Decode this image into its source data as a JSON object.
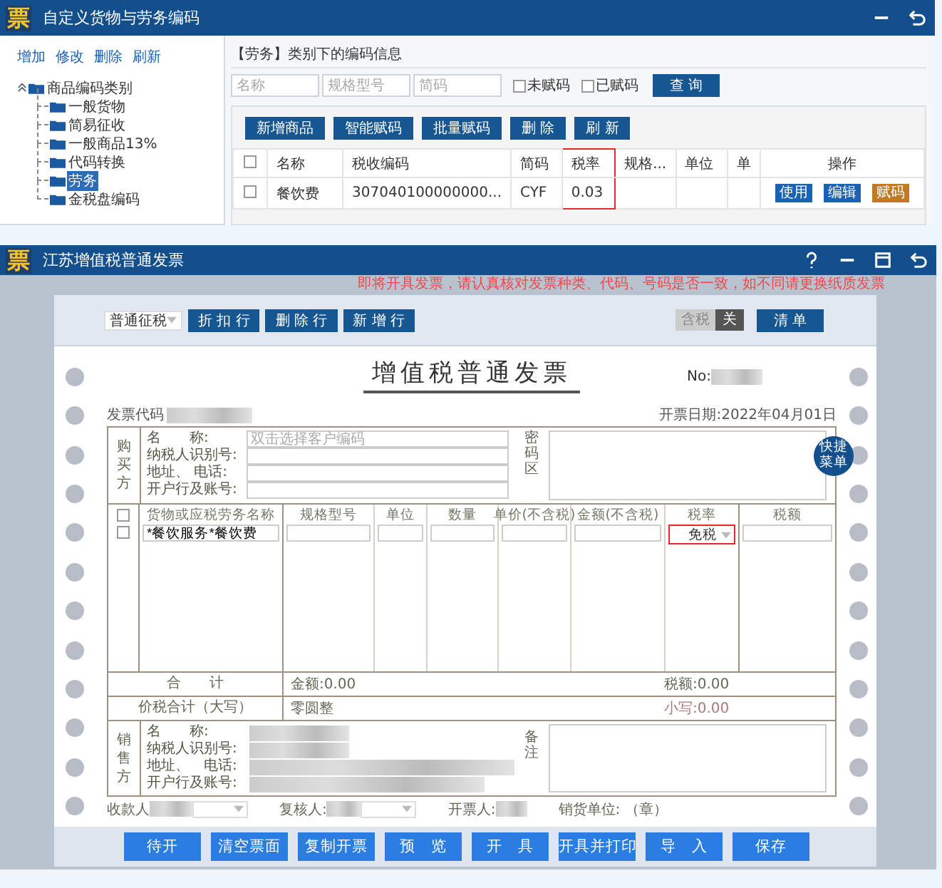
{
  "code_window": {
    "logo": "票",
    "title": "自定义货物与劳务编码",
    "actions": [
      "增加",
      "修改",
      "删除",
      "刷新"
    ],
    "tree": {
      "label": "商品编码类别",
      "expanded": true,
      "children": [
        {
          "label": "一般货物",
          "selected": false
        },
        {
          "label": "简易征收",
          "selected": false
        },
        {
          "label": "一般商品13%",
          "selected": false
        },
        {
          "label": "代码转换",
          "selected": false
        },
        {
          "label": "劳务",
          "selected": true
        },
        {
          "label": "金税盘编码",
          "selected": false
        }
      ]
    },
    "heading": "【劳务】类别下的编码信息",
    "filters": [
      {
        "placeholder": "名称"
      },
      {
        "placeholder": "规格型号"
      },
      {
        "placeholder": "简码"
      }
    ],
    "checks": [
      {
        "label": "未赋码",
        "checked": false
      },
      {
        "label": "已赋码",
        "checked": false
      }
    ],
    "query_button": "查 询",
    "toolbar": [
      "新增商品",
      "智能赋码",
      "批量赋码",
      "删 除",
      "刷 新"
    ],
    "table": {
      "header_checked": false,
      "columns": [
        {
          "label": "名称",
          "highlighted": false
        },
        {
          "label": "税收编码",
          "highlighted": false
        },
        {
          "label": "简码",
          "highlighted": false
        },
        {
          "label": "税率",
          "highlighted": true
        },
        {
          "label": "规格...",
          "highlighted": false
        },
        {
          "label": "单位",
          "highlighted": false
        },
        {
          "label": "单",
          "highlighted": false
        }
      ],
      "action_column": "操作",
      "rows": [
        {
          "checked": false,
          "cells": [
            "餐饮费",
            "307040100000000...",
            "CYF",
            "0.03"
          ],
          "actions": [
            {
              "label": "使用",
              "kind": "primary"
            },
            {
              "label": "编辑",
              "kind": "primary"
            },
            {
              "label": "赋码",
              "kind": "warning"
            }
          ]
        }
      ]
    }
  },
  "invoice_window": {
    "logo": "票",
    "title": "江苏增值税普通发票",
    "notice": "即将开具发票，请认真核对发票种类、代码、号码是否一致，如不同请更换纸质发票",
    "tax_mode": "普通征税",
    "row_buttons": [
      "折 扣 行",
      "删 除 行",
      "新 增 行"
    ],
    "tax_toggle": {
      "label": "含税",
      "state_label": "关",
      "on": false
    },
    "list_button": "清 单",
    "invoice": {
      "title": "增值税普通发票",
      "no_label": "No:",
      "code_label": "发票代码",
      "date": "开票日期:2022年04月01日",
      "buyer": {
        "side_label": "购买方",
        "fields": [
          {
            "label": "名　　称:",
            "placeholder": "双击选择客户编码"
          },
          {
            "label": "纳税人识别号:"
          },
          {
            "label": "地址、 电话:"
          },
          {
            "label": "开户行及账号:"
          }
        ],
        "cipher_label": "密码区"
      },
      "quick_menu": "快捷菜单",
      "columns": [
        "货物或应税劳务名称",
        "规格型号",
        "单位",
        "数量",
        "单价(不含税)",
        "金额(不含税)",
        "税率",
        "税额"
      ],
      "checks": [
        {
          "checked": false
        },
        {
          "checked": false
        }
      ],
      "items": [
        {
          "name": "*餐饮服务*餐饮费",
          "rate": "免税",
          "highlighted": true
        }
      ],
      "totals": {
        "label": "合　　计",
        "amount": "金额:0.00",
        "tax": "税额:0.00"
      },
      "grand": {
        "label": "价税合计（大写）",
        "words": "零圆整",
        "figures": "小写:0.00"
      },
      "seller": {
        "side_label": "销售方",
        "fields": [
          "名　　称:",
          "纳税人识别号:",
          "地址、　电话:",
          "开户行及账号:"
        ],
        "remark_label": "备注"
      },
      "signers": [
        {
          "label": "收款人",
          "kind": "select"
        },
        {
          "label": "复核人:",
          "kind": "select"
        },
        {
          "label": "开票人:",
          "kind": "plain"
        },
        {
          "label": "销货单位: （章）",
          "kind": "text"
        }
      ]
    },
    "buttons": [
      "待开",
      "清空票面",
      "复制开票",
      "预　览",
      "开　具",
      "开具并打印",
      "导　入",
      "保存"
    ]
  }
}
